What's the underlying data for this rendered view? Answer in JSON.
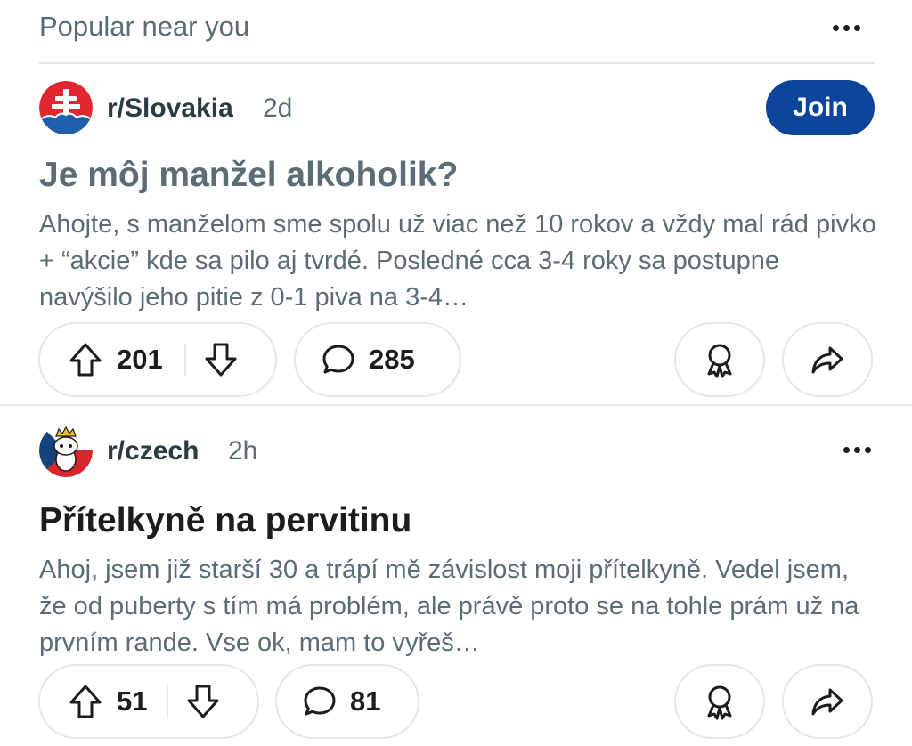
{
  "section": {
    "title": "Popular near you"
  },
  "posts": [
    {
      "subreddit": "r/Slovakia",
      "age": "2d",
      "join_label": "Join",
      "title": "Je môj manžel alkoholik?",
      "body": "Ahojte, s manželom sme spolu už viac než 10 rokov a vždy mal rád pivko + “akcie” kde sa pilo aj tvrdé. Posledné cca 3-4 roky sa postupne navýšilo jeho pitie z 0-1 piva na 3-4…",
      "votes": "201",
      "comments": "285",
      "avatar_icon": "slovak-cross-icon",
      "avatar_colors": {
        "red": "#e0282e",
        "blue": "#1f5fae",
        "white": "#ffffff"
      }
    },
    {
      "subreddit": "r/czech",
      "age": "2h",
      "title": "Přítelkyně na pervitinu",
      "body": "Ahoj, jsem již starší 30 a trápí mě závislost moji přítelkyně. Vedel jsem, že od puberty s tím má problém, ale právě proto se na tohle prám už na prvním rande. Vse ok, mam to vyřeš…",
      "votes": "51",
      "comments": "81",
      "avatar_icon": "crowned-snoo-icon",
      "avatar_colors": {
        "red": "#d7262c",
        "blue": "#14427a",
        "white": "#ffffff",
        "gold": "#f4c21b"
      }
    }
  ],
  "icons": {
    "upvote": "upvote-arrow-icon",
    "downvote": "downvote-arrow-icon",
    "comment": "comment-bubble-icon",
    "award": "award-ribbon-icon",
    "share": "share-arrow-icon",
    "more": "more-dots-icon"
  },
  "colors": {
    "join_button": "#0a449b",
    "muted_text": "#5c6c74",
    "primary_text": "#1c1c1c",
    "divider": "#e5e7e9"
  }
}
